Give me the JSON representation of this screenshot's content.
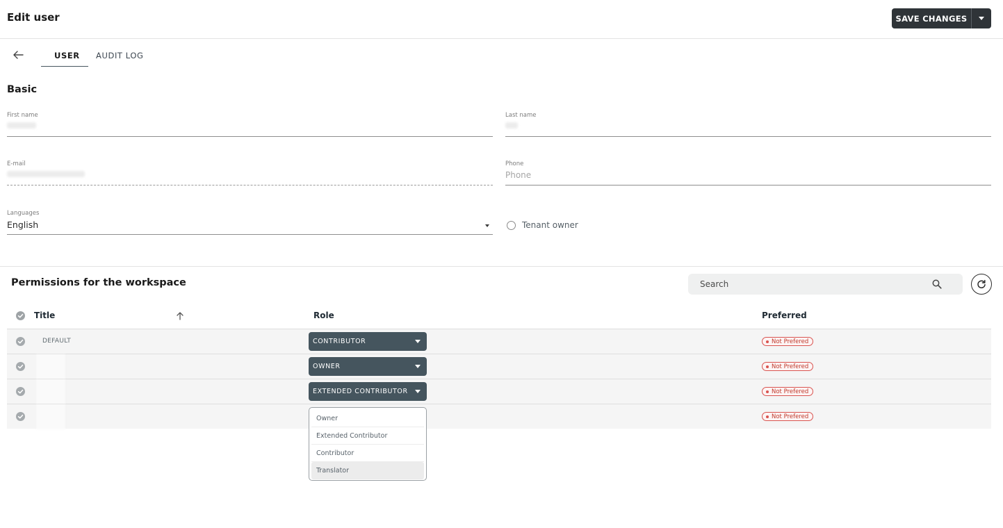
{
  "header": {
    "title": "Edit user",
    "save_label": "SAVE CHANGES"
  },
  "tabs": [
    {
      "label": "USER",
      "active": true
    },
    {
      "label": "AUDIT LOG",
      "active": false
    }
  ],
  "basic": {
    "title": "Basic",
    "first_name": {
      "label": "First name",
      "value": ""
    },
    "last_name": {
      "label": "Last name",
      "value": ""
    },
    "email": {
      "label": "E-mail",
      "value": ""
    },
    "phone": {
      "label": "Phone",
      "placeholder": "Phone",
      "value": ""
    },
    "languages": {
      "label": "Languages",
      "value": "English"
    },
    "tenant_owner": {
      "label": "Tenant owner",
      "checked": false
    }
  },
  "permissions": {
    "title": "Permissions for the workspace",
    "search_placeholder": "Search",
    "columns": {
      "title": "Title",
      "role": "Role",
      "preferred": "Preferred"
    },
    "rows": [
      {
        "title": "DEFAULT",
        "role": "CONTRIBUTOR",
        "preferred": "Not Prefered"
      },
      {
        "title": "",
        "role": "OWNER",
        "preferred": "Not Prefered"
      },
      {
        "title": "",
        "role": "EXTENDED CONTRIBUTOR",
        "preferred": "Not Prefered"
      },
      {
        "title": "",
        "role": "",
        "preferred": "Not Prefered"
      }
    ],
    "role_options": [
      "Owner",
      "Extended Contributor",
      "Contributor",
      "Translator"
    ],
    "highlighted_option": "Translator"
  },
  "colors": {
    "primary_dark": "#2f3438",
    "role_select": "#45555e",
    "badge_red": "#d9534f",
    "row_bg": "#f5f5f5"
  }
}
